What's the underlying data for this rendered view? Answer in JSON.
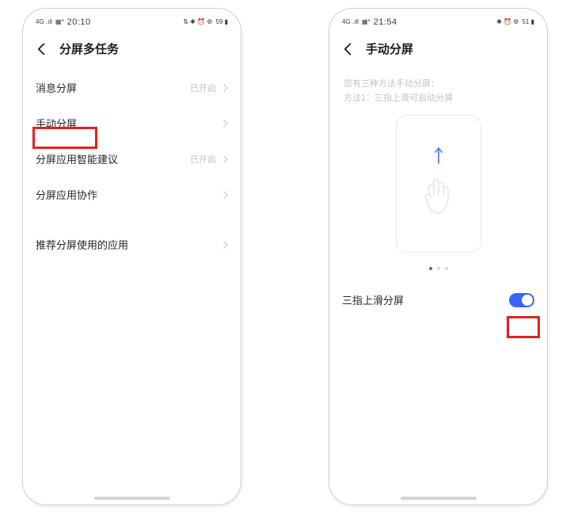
{
  "phone1": {
    "status": {
      "signal": "4G .ıll",
      "extra": "▦*",
      "time": "20:10",
      "icons": "⇅ ✱ ⏰ ⚙",
      "battery": "59 ▮"
    },
    "title": "分屏多任务",
    "rows": [
      {
        "label": "消息分屏",
        "sub": "已开启"
      },
      {
        "label": "手动分屏",
        "sub": ""
      },
      {
        "label": "分屏应用智能建议",
        "sub": "已开启"
      },
      {
        "label": "分屏应用协作",
        "sub": ""
      }
    ],
    "row_last": {
      "label": "推荐分屏使用的应用",
      "sub": ""
    }
  },
  "phone2": {
    "status": {
      "signal": "4G .ıll",
      "extra": "▦*",
      "time": "21:54",
      "icons": "✱ ⏰ ⚙",
      "battery": "51 ▮"
    },
    "title": "手动分屏",
    "desc_line1": "您有三种方法手动分屏：",
    "desc_line2": "方法1：三指上滑可启动分屏",
    "toggle_label": "三指上滑分屏"
  }
}
